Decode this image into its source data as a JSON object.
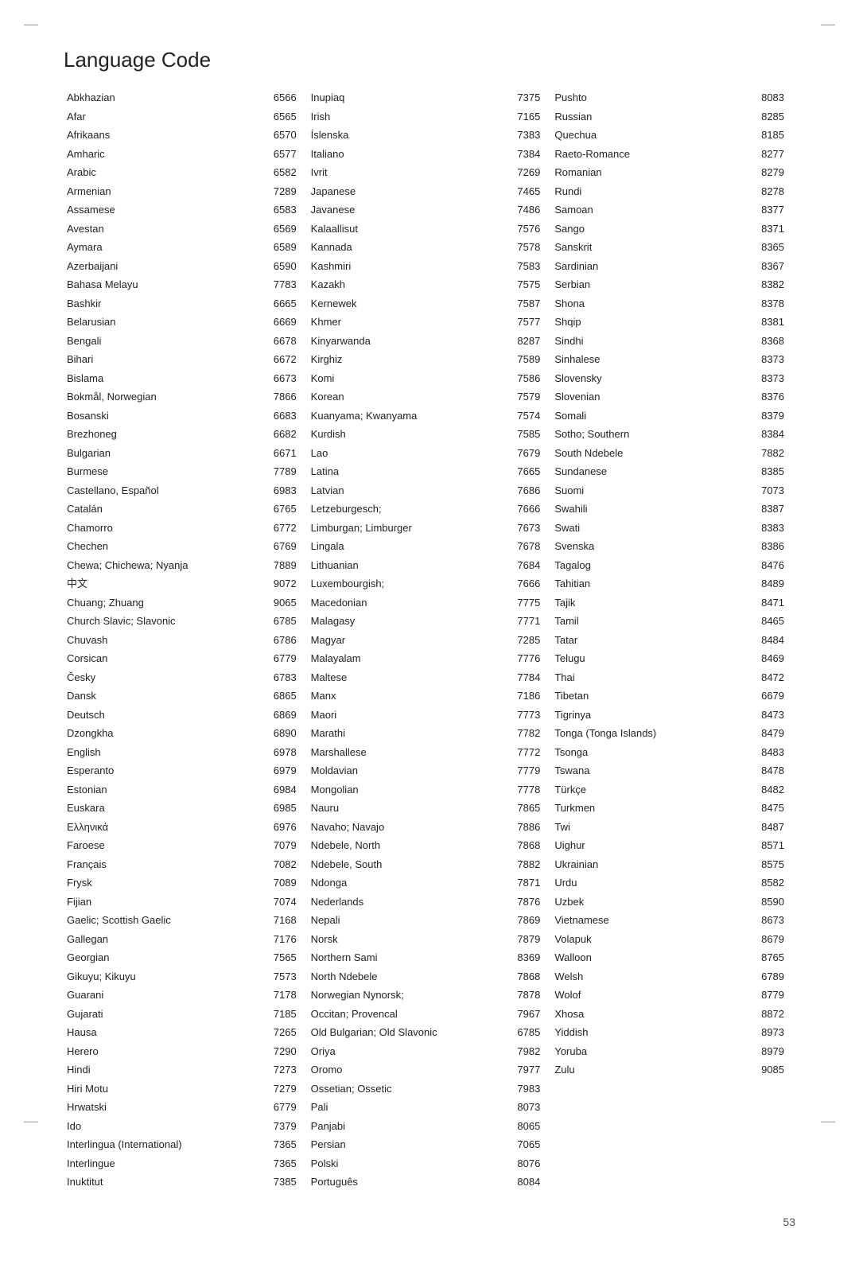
{
  "page": {
    "title": "Language Code",
    "page_number": "53"
  },
  "columns": [
    {
      "id": "col1",
      "rows": [
        [
          "Abkhazian",
          "6566"
        ],
        [
          "Afar",
          "6565"
        ],
        [
          "Afrikaans",
          "6570"
        ],
        [
          "Amharic",
          "6577"
        ],
        [
          "Arabic",
          "6582"
        ],
        [
          "Armenian",
          "7289"
        ],
        [
          "Assamese",
          "6583"
        ],
        [
          "Avestan",
          "6569"
        ],
        [
          "Aymara",
          "6589"
        ],
        [
          "Azerbaijani",
          "6590"
        ],
        [
          "Bahasa Melayu",
          "7783"
        ],
        [
          "Bashkir",
          "6665"
        ],
        [
          "Belarusian",
          "6669"
        ],
        [
          "Bengali",
          "6678"
        ],
        [
          "Bihari",
          "6672"
        ],
        [
          "Bislama",
          "6673"
        ],
        [
          "Bokmål, Norwegian",
          "7866"
        ],
        [
          "Bosanski",
          "6683"
        ],
        [
          "Brezhoneg",
          "6682"
        ],
        [
          "Bulgarian",
          "6671"
        ],
        [
          "Burmese",
          "7789"
        ],
        [
          "Castellano, Español",
          "6983"
        ],
        [
          "Catalán",
          "6765"
        ],
        [
          "Chamorro",
          "6772"
        ],
        [
          "Chechen",
          "6769"
        ],
        [
          "Chewa; Chichewa; Nyanja",
          "7889"
        ],
        [
          "中文",
          "9072"
        ],
        [
          "Chuang; Zhuang",
          "9065"
        ],
        [
          "Church Slavic; Slavonic",
          "6785"
        ],
        [
          "Chuvash",
          "6786"
        ],
        [
          "Corsican",
          "6779"
        ],
        [
          "Česky",
          "6783"
        ],
        [
          "Dansk",
          "6865"
        ],
        [
          "Deutsch",
          "6869"
        ],
        [
          "Dzongkha",
          "6890"
        ],
        [
          "English",
          "6978"
        ],
        [
          "Esperanto",
          "6979"
        ],
        [
          "Estonian",
          "6984"
        ],
        [
          "Euskara",
          "6985"
        ],
        [
          "Ελληνικά",
          "6976"
        ],
        [
          "Faroese",
          "7079"
        ],
        [
          "Français",
          "7082"
        ],
        [
          "Frysk",
          "7089"
        ],
        [
          "Fijian",
          "7074"
        ],
        [
          "Gaelic; Scottish Gaelic",
          "7168"
        ],
        [
          "Gallegan",
          "7176"
        ],
        [
          "Georgian",
          "7565"
        ],
        [
          "Gikuyu; Kikuyu",
          "7573"
        ],
        [
          "Guarani",
          "7178"
        ],
        [
          "Gujarati",
          "7185"
        ],
        [
          "Hausa",
          "7265"
        ],
        [
          "Herero",
          "7290"
        ],
        [
          "Hindi",
          "7273"
        ],
        [
          "Hiri Motu",
          "7279"
        ],
        [
          "Hrwatski",
          "6779"
        ],
        [
          "Ido",
          "7379"
        ],
        [
          "Interlingua (International)",
          "7365"
        ],
        [
          "Interlingue",
          "7365"
        ],
        [
          "Inuktitut",
          "7385"
        ]
      ]
    },
    {
      "id": "col2",
      "rows": [
        [
          "Inupiaq",
          "7375"
        ],
        [
          "Irish",
          "7165"
        ],
        [
          "Íslenska",
          "7383"
        ],
        [
          "Italiano",
          "7384"
        ],
        [
          "Ivrit",
          "7269"
        ],
        [
          "Japanese",
          "7465"
        ],
        [
          "Javanese",
          "7486"
        ],
        [
          "Kalaallisut",
          "7576"
        ],
        [
          "Kannada",
          "7578"
        ],
        [
          "Kashmiri",
          "7583"
        ],
        [
          "Kazakh",
          "7575"
        ],
        [
          "Kernewek",
          "7587"
        ],
        [
          "Khmer",
          "7577"
        ],
        [
          "Kinyarwanda",
          "8287"
        ],
        [
          "Kirghiz",
          "7589"
        ],
        [
          "Komi",
          "7586"
        ],
        [
          "Korean",
          "7579"
        ],
        [
          "Kuanyama; Kwanyama",
          "7574"
        ],
        [
          "Kurdish",
          "7585"
        ],
        [
          "Lao",
          "7679"
        ],
        [
          "Latina",
          "7665"
        ],
        [
          "Latvian",
          "7686"
        ],
        [
          "Letzeburgesch;",
          "7666"
        ],
        [
          "Limburgan; Limburger",
          "7673"
        ],
        [
          "Lingala",
          "7678"
        ],
        [
          "Lithuanian",
          "7684"
        ],
        [
          "Luxembourgish;",
          "7666"
        ],
        [
          "Macedonian",
          "7775"
        ],
        [
          "Malagasy",
          "7771"
        ],
        [
          "Magyar",
          "7285"
        ],
        [
          "Malayalam",
          "7776"
        ],
        [
          "Maltese",
          "7784"
        ],
        [
          "Manx",
          "7186"
        ],
        [
          "Maori",
          "7773"
        ],
        [
          "Marathi",
          "7782"
        ],
        [
          "Marshallese",
          "7772"
        ],
        [
          "Moldavian",
          "7779"
        ],
        [
          "Mongolian",
          "7778"
        ],
        [
          "Nauru",
          "7865"
        ],
        [
          "Navaho; Navajo",
          "7886"
        ],
        [
          "Ndebele, North",
          "7868"
        ],
        [
          "Ndebele, South",
          "7882"
        ],
        [
          "Ndonga",
          "7871"
        ],
        [
          "Nederlands",
          "7876"
        ],
        [
          "Nepali",
          "7869"
        ],
        [
          "Norsk",
          "7879"
        ],
        [
          "Northern Sami",
          "8369"
        ],
        [
          "North Ndebele",
          "7868"
        ],
        [
          "Norwegian Nynorsk;",
          "7878"
        ],
        [
          "Occitan; Provencal",
          "7967"
        ],
        [
          "Old Bulgarian; Old Slavonic",
          "6785"
        ],
        [
          "Oriya",
          "7982"
        ],
        [
          "Oromo",
          "7977"
        ],
        [
          "Ossetian; Ossetic",
          "7983"
        ],
        [
          "Pali",
          "8073"
        ],
        [
          "Panjabi",
          "8065"
        ],
        [
          "Persian",
          "7065"
        ],
        [
          "Polski",
          "8076"
        ],
        [
          "Português",
          "8084"
        ]
      ]
    },
    {
      "id": "col3",
      "rows": [
        [
          "Pushto",
          "8083"
        ],
        [
          "Russian",
          "8285"
        ],
        [
          "Quechua",
          "8185"
        ],
        [
          "Raeto-Romance",
          "8277"
        ],
        [
          "Romanian",
          "8279"
        ],
        [
          "Rundi",
          "8278"
        ],
        [
          "Samoan",
          "8377"
        ],
        [
          "Sango",
          "8371"
        ],
        [
          "Sanskrit",
          "8365"
        ],
        [
          "Sardinian",
          "8367"
        ],
        [
          "Serbian",
          "8382"
        ],
        [
          "Shona",
          "8378"
        ],
        [
          "Shqip",
          "8381"
        ],
        [
          "Sindhi",
          "8368"
        ],
        [
          "Sinhalese",
          "8373"
        ],
        [
          "Slovensky",
          "8373"
        ],
        [
          "Slovenian",
          "8376"
        ],
        [
          "Somali",
          "8379"
        ],
        [
          "Sotho; Southern",
          "8384"
        ],
        [
          "South Ndebele",
          "7882"
        ],
        [
          "Sundanese",
          "8385"
        ],
        [
          "Suomi",
          "7073"
        ],
        [
          "Swahili",
          "8387"
        ],
        [
          "Swati",
          "8383"
        ],
        [
          "Svenska",
          "8386"
        ],
        [
          "Tagalog",
          "8476"
        ],
        [
          "Tahitian",
          "8489"
        ],
        [
          "Tajik",
          "8471"
        ],
        [
          "Tamil",
          "8465"
        ],
        [
          "Tatar",
          "8484"
        ],
        [
          "Telugu",
          "8469"
        ],
        [
          "Thai",
          "8472"
        ],
        [
          "Tibetan",
          "6679"
        ],
        [
          "Tigrinya",
          "8473"
        ],
        [
          "Tonga (Tonga Islands)",
          "8479"
        ],
        [
          "Tsonga",
          "8483"
        ],
        [
          "Tswana",
          "8478"
        ],
        [
          "Türkçe",
          "8482"
        ],
        [
          "Turkmen",
          "8475"
        ],
        [
          "Twi",
          "8487"
        ],
        [
          "Uighur",
          "8571"
        ],
        [
          "Ukrainian",
          "8575"
        ],
        [
          "Urdu",
          "8582"
        ],
        [
          "Uzbek",
          "8590"
        ],
        [
          "Vietnamese",
          "8673"
        ],
        [
          "Volapuk",
          "8679"
        ],
        [
          "Walloon",
          "8765"
        ],
        [
          "Welsh",
          "6789"
        ],
        [
          "Wolof",
          "8779"
        ],
        [
          "Xhosa",
          "8872"
        ],
        [
          "Yiddish",
          "8973"
        ],
        [
          "Yoruba",
          "8979"
        ],
        [
          "Zulu",
          "9085"
        ]
      ]
    }
  ]
}
